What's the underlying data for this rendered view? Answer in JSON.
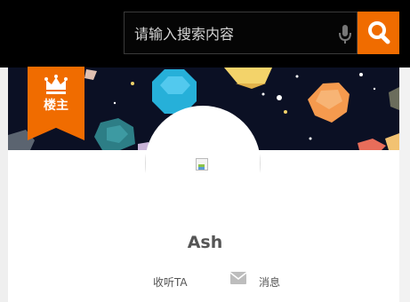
{
  "search": {
    "placeholder": "请输入搜索内容"
  },
  "icons": {
    "mic": "microphone-icon",
    "search": "search-icon",
    "crown": "crown-icon",
    "message": "mail-icon"
  },
  "colors": {
    "accent": "#f06c00",
    "topbar": "#000000",
    "banner": "#0b1024"
  },
  "profile": {
    "badge_label": "楼主",
    "username": "Ash",
    "follow_label": "收听TA",
    "message_label": "消息"
  }
}
